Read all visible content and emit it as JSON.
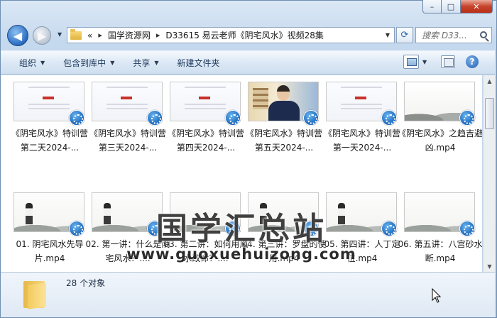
{
  "window": {
    "caption": {
      "min": "–",
      "max": "□",
      "close": "✕"
    }
  },
  "address": {
    "prefix": "«",
    "crumbs": [
      "国学资源网",
      "D33615 易云老师《阴宅风水》视频28集"
    ],
    "separator": "▸"
  },
  "search": {
    "placeholder": "搜索 D33..."
  },
  "toolbar": {
    "organize": "组织",
    "include_library": "包含到库中",
    "share": "共享",
    "new_folder": "新建文件夹"
  },
  "files": [
    {
      "name": "《阴宅风水》特训营 第二天2024-...",
      "thumb": "slide"
    },
    {
      "name": "《阴宅风水》特训营 第三天2024-...",
      "thumb": "slide"
    },
    {
      "name": "《阴宅风水》特训营 第四天2024-...",
      "thumb": "slide"
    },
    {
      "name": "《阴宅风水》特训营 第五天2024-...",
      "thumb": "person"
    },
    {
      "name": "《阴宅风水》特训营 第一天2024-...",
      "thumb": "slide"
    },
    {
      "name": "《阴宅风水》之趋吉避凶.mp4",
      "thumb": "ink"
    },
    {
      "name": "01. 阴宅风水先导片.mp4",
      "thumb": "lecture"
    },
    {
      "name": "02. 第一讲：什么是阴宅风水？....",
      "thumb": "lecture"
    },
    {
      "name": "03. 第二讲：如何用风水改命？....",
      "thumb": "lecture"
    },
    {
      "name": "04. 第三讲：罗盘的使用.mp4",
      "thumb": "lecture"
    },
    {
      "name": "05. 第四讲：人丁定位.mp4",
      "thumb": "lecture"
    },
    {
      "name": "06. 第五讲：八宫砂水断.mp4",
      "thumb": "lecture"
    }
  ],
  "watermark": {
    "cn": "国学汇总站",
    "url": "www.guoxuehuizong.com"
  },
  "status": {
    "count": "28 个对象"
  }
}
